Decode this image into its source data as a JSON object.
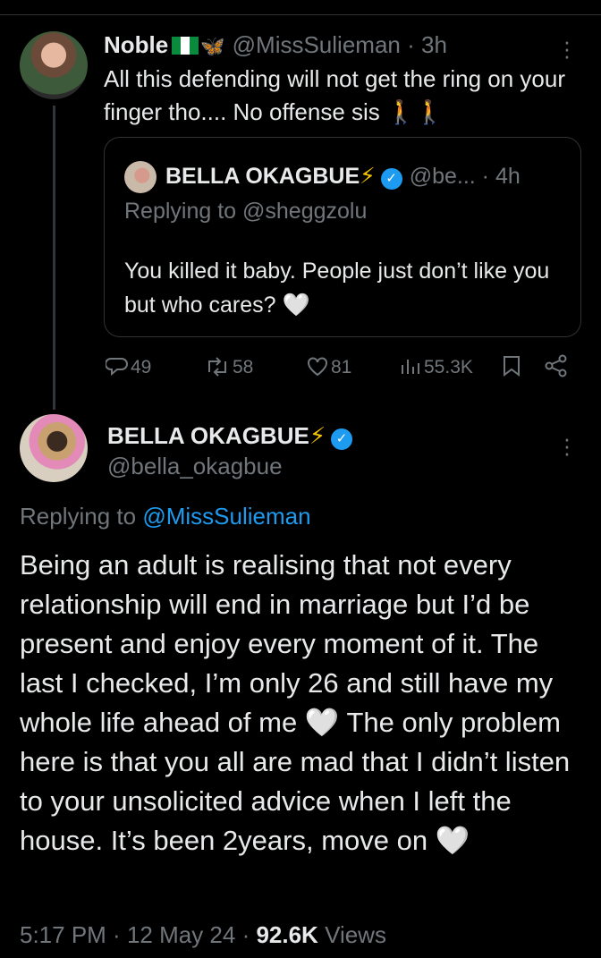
{
  "reply_tweet": {
    "author_name": "Noble",
    "handle": "@MissSulieman",
    "time": "3h",
    "text": "All this defending will not get the ring on your finger tho.... No offense sis",
    "emoji_trail": "🚶🚶",
    "quoted": {
      "author_name": "BELLA OKAGBUE",
      "handle": "@be...",
      "time": "4h",
      "replying_to": "Replying to @sheggzolu",
      "text": "You killed it baby. People just don’t like you but who cares?",
      "emoji": "🤍"
    },
    "stats": {
      "replies": "49",
      "reposts": "58",
      "likes": "81",
      "views": "55.3K"
    }
  },
  "main_tweet": {
    "author_name": "BELLA OKAGBUE",
    "handle": "@bella_okagbue",
    "replying_prefix": "Replying to ",
    "replying_mention": "@MissSulieman",
    "text_part1": "Being an adult is realising that not every relationship will end in marriage but I’d be present and enjoy every moment of it. The last I checked, I’m only 26 and still have my whole life ahead of me ",
    "text_part2": " The only problem here is that you all are mad that I didn’t listen to your unsolicited advice when I left the house. It’s been 2years, move on ",
    "emoji": "🤍",
    "time": "5:17 PM",
    "date": "12 May 24",
    "views_count": "92.6K",
    "views_label": "Views"
  },
  "colors": {
    "background": "#000000",
    "text": "#e7e9ea",
    "muted": "#71767b",
    "accent": "#1d9bf0",
    "border": "#2f3336"
  },
  "icons": [
    "more-icon",
    "verified-badge-icon",
    "lightning-icon",
    "reply-icon",
    "repost-icon",
    "like-icon",
    "views-icon",
    "bookmark-icon",
    "share-icon",
    "flag-icon",
    "butterfly-icon"
  ]
}
